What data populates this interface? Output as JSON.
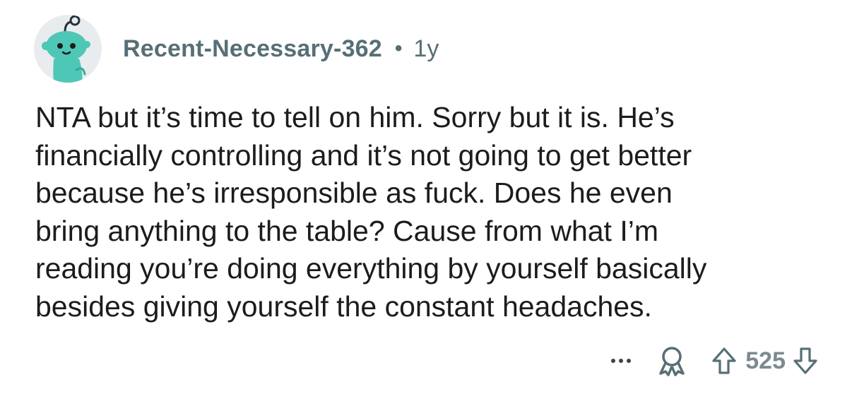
{
  "comment": {
    "username": "Recent-Necessary-362",
    "separator": "•",
    "age": "1y",
    "body_lines": [
      "NTA but it’s time to tell on him. Sorry but it is. He’s",
      "financially controlling and it’s not going to get better",
      "because he’s irresponsible as fuck. Does he even",
      "bring anything to the table? Cause from what I’m",
      "reading you’re doing everything by yourself basically",
      "besides giving yourself the constant headaches."
    ]
  },
  "actions": {
    "score": "525",
    "icons": [
      "more-icon",
      "award-icon",
      "upvote-icon",
      "downvote-icon"
    ]
  },
  "colors": {
    "avatar_bg": "#e9ecee",
    "avatar_body": "#4fc7b7",
    "meta_text": "#576f76",
    "body_text": "#1c1c1c"
  }
}
